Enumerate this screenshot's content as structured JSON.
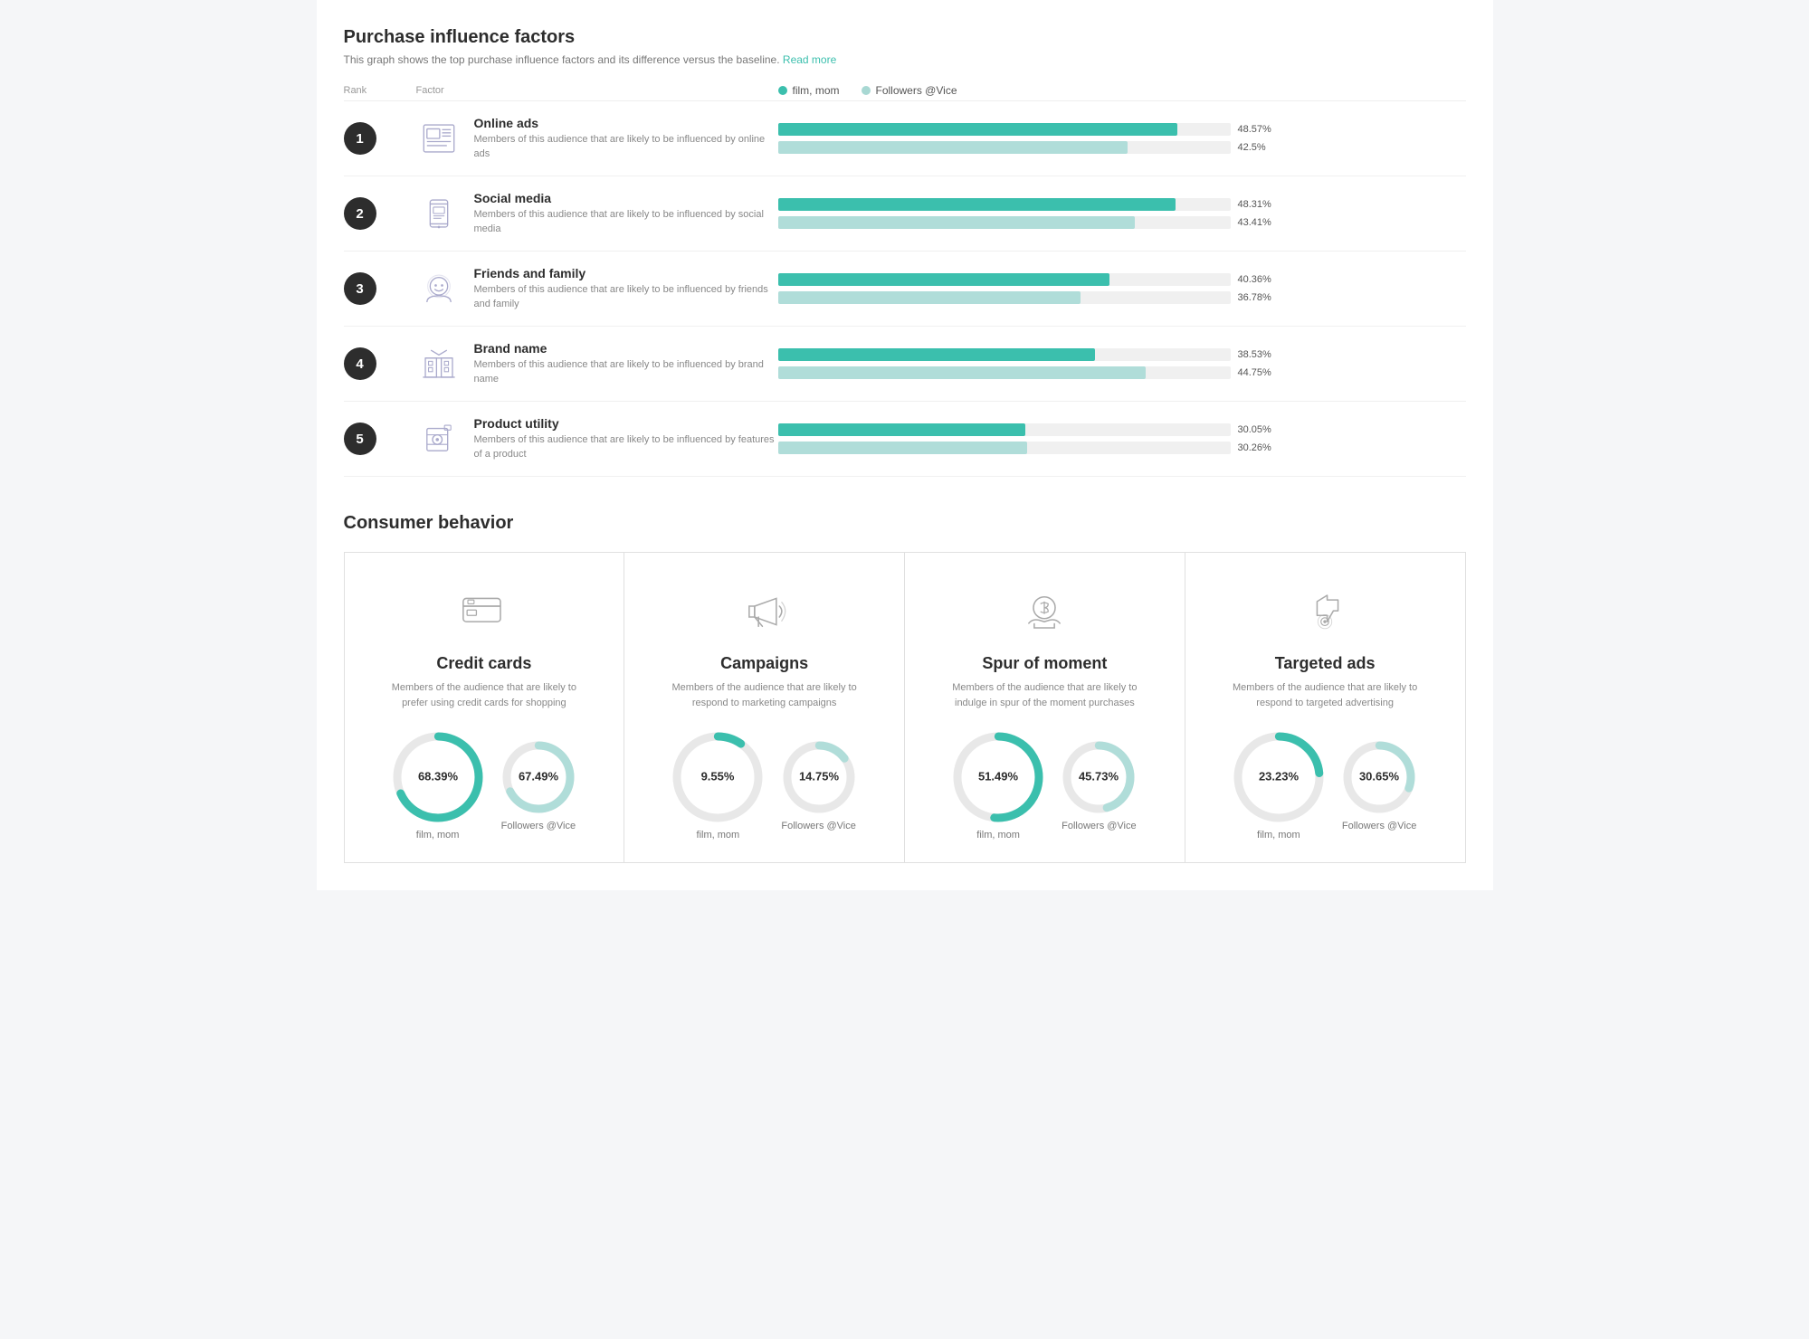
{
  "page": {
    "purchaseSection": {
      "title": "Purchase influence factors",
      "subtitle": "This graph shows the top purchase influence factors and its difference versus the baseline.",
      "readMoreLabel": "Read more",
      "legend": {
        "series1Label": "film, mom",
        "series2Label": "Followers @Vice"
      },
      "tableHeaders": {
        "rank": "Rank",
        "factor": "Factor"
      },
      "factors": [
        {
          "rank": "1",
          "name": "Online ads",
          "description": "Members of this audience that are likely to be influenced by online ads",
          "series1": {
            "value": 48.57,
            "pct": 97
          },
          "series2": {
            "value": 42.5,
            "pct": 85
          }
        },
        {
          "rank": "2",
          "name": "Social media",
          "description": "Members of this audience that are likely to be influenced by social media",
          "series1": {
            "value": 48.31,
            "pct": 96
          },
          "series2": {
            "value": 43.41,
            "pct": 87
          }
        },
        {
          "rank": "3",
          "name": "Friends and family",
          "description": "Members of this audience that are likely to be influenced by friends and family",
          "series1": {
            "value": 40.36,
            "pct": 80
          },
          "series2": {
            "value": 36.78,
            "pct": 73
          }
        },
        {
          "rank": "4",
          "name": "Brand name",
          "description": "Members of this audience that are likely to be influenced by brand name",
          "series1": {
            "value": 38.53,
            "pct": 77
          },
          "series2": {
            "value": 44.75,
            "pct": 89
          }
        },
        {
          "rank": "5",
          "name": "Product utility",
          "description": "Members of this audience that are likely to be influenced by features of a product",
          "series1": {
            "value": 30.05,
            "pct": 60
          },
          "series2": {
            "value": 30.26,
            "pct": 60.5
          }
        }
      ]
    },
    "consumerSection": {
      "title": "Consumer behavior",
      "cards": [
        {
          "name": "Credit cards",
          "description": "Members of the audience that are likely to prefer using credit cards for shopping",
          "series1": {
            "value": "68.39%",
            "pct": 68.39,
            "label": "film, mom"
          },
          "series2": {
            "value": "67.49%",
            "pct": 67.49,
            "label": "Followers @Vice"
          }
        },
        {
          "name": "Campaigns",
          "description": "Members of the audience that are likely to respond to marketing campaigns",
          "series1": {
            "value": "9.55%",
            "pct": 9.55,
            "label": "film, mom"
          },
          "series2": {
            "value": "14.75%",
            "pct": 14.75,
            "label": "Followers @Vice"
          }
        },
        {
          "name": "Spur of moment",
          "description": "Members of the audience that are likely to indulge in spur of the moment purchases",
          "series1": {
            "value": "51.49%",
            "pct": 51.49,
            "label": "film, mom"
          },
          "series2": {
            "value": "45.73%",
            "pct": 45.73,
            "label": "Followers @Vice"
          }
        },
        {
          "name": "Targeted ads",
          "description": "Members of the audience that are likely to respond to targeted advertising",
          "series1": {
            "value": "23.23%",
            "pct": 23.23,
            "label": "film, mom"
          },
          "series2": {
            "value": "30.65%",
            "pct": 30.65,
            "label": "Followers @Vice"
          }
        }
      ]
    }
  }
}
